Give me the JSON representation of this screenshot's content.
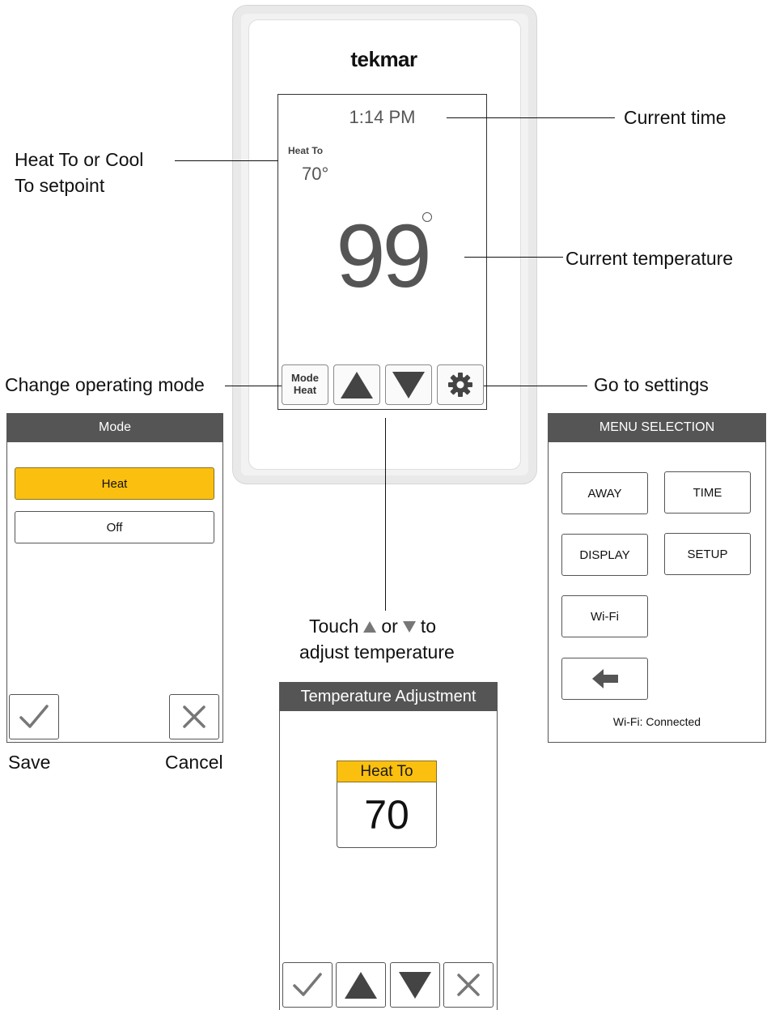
{
  "thermostat": {
    "brand": "tekmar",
    "time": "1:14 PM",
    "setpoint_label": "Heat To",
    "setpoint_value": "70°",
    "current_temp": "99",
    "mode_button": {
      "line1": "Mode",
      "line2": "Heat"
    },
    "icons": [
      "arrow-up-icon",
      "arrow-down-icon",
      "gear-icon"
    ]
  },
  "callouts": {
    "setpoint_line1": "Heat To or Cool",
    "setpoint_line2": "To setpoint",
    "current_time": "Current time",
    "current_temperature": "Current temperature",
    "change_mode": "Change operating mode",
    "go_settings": "Go to settings",
    "touch_word": "Touch",
    "or_word": "or",
    "to_word": "to",
    "adjust_line": "adjust temperature"
  },
  "mode_panel": {
    "title": "Mode",
    "options": [
      {
        "label": "Heat",
        "selected": true
      },
      {
        "label": "Off",
        "selected": false
      }
    ],
    "save_label": "Save",
    "cancel_label": "Cancel"
  },
  "temp_panel": {
    "title": "Temperature Adjustment",
    "setpoint_label": "Heat To",
    "setpoint_value": "70"
  },
  "menu_panel": {
    "title": "MENU SELECTION",
    "buttons": [
      "AWAY",
      "TIME",
      "DISPLAY",
      "SETUP",
      "Wi-Fi"
    ],
    "status": "Wi-Fi: Connected"
  },
  "colors": {
    "accent_yellow": "#fbc00f",
    "header_gray": "#555555",
    "icon_gray": "#444444"
  }
}
